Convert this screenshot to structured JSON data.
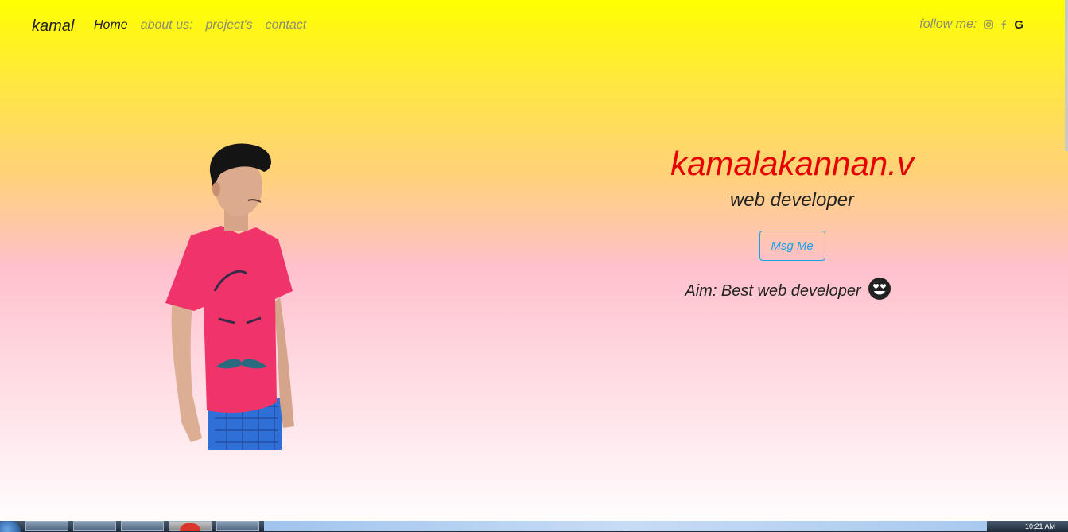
{
  "navbar": {
    "brand": "kamal",
    "links": [
      "Home",
      "about us:",
      "project's",
      "contact"
    ],
    "active_link": "Home",
    "follow_label": "follow me:",
    "social_icons": [
      "instagram-icon",
      "facebook-icon",
      "google-icon"
    ],
    "google_glyph": "G"
  },
  "hero": {
    "name": "kamalakannan.v",
    "role": "web developer",
    "button_label": "Msg Me",
    "aim": "Aim: Best web developer",
    "aim_emoji": "heart-eyes-emoji-icon"
  },
  "colors": {
    "gradient_top": "#ffff00",
    "gradient_mid": "#ffc0cb",
    "gradient_bottom": "#ffffff",
    "name_color": "#e60000",
    "button_color": "#17a2e8",
    "shirt_color": "#f0346a"
  },
  "taskbar": {
    "clock_text": "10:21 AM"
  }
}
